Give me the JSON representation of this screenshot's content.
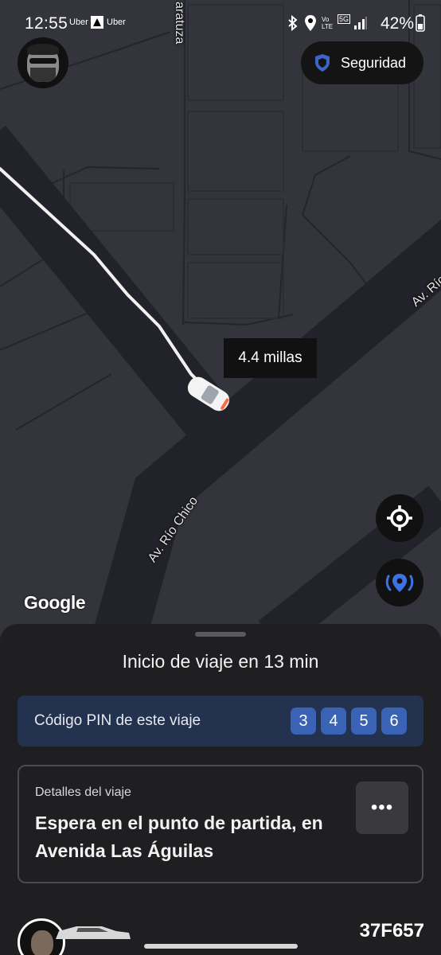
{
  "status_bar": {
    "time": "12:55",
    "notif_1": "Uber",
    "notif_2": "Uber",
    "network": "5G",
    "volte": "Vo LTE",
    "battery": "42%"
  },
  "header": {
    "security_label": "Seguridad"
  },
  "map": {
    "street_top": "aratuza",
    "street_right": "Av. Río",
    "street_left": "Av. Río Chico",
    "distance_label": "4.4 millas",
    "attribution": "Google"
  },
  "sheet": {
    "title": "Inicio de viaje en 13 min",
    "pin_label": "Código PIN de este viaje",
    "pin_digits": [
      "3",
      "4",
      "5",
      "6"
    ],
    "details_label": "Detalles del viaje",
    "details_text": "Espera en el punto de partida, en Avenida Las Águilas",
    "more_glyph": "•••",
    "plate": "37F657"
  },
  "colors": {
    "map_bg": "#33343c",
    "road": "#22232a",
    "pin_card": "#23324f",
    "pin_digit": "#3b63b5",
    "accent_blue": "#3c72e6"
  }
}
